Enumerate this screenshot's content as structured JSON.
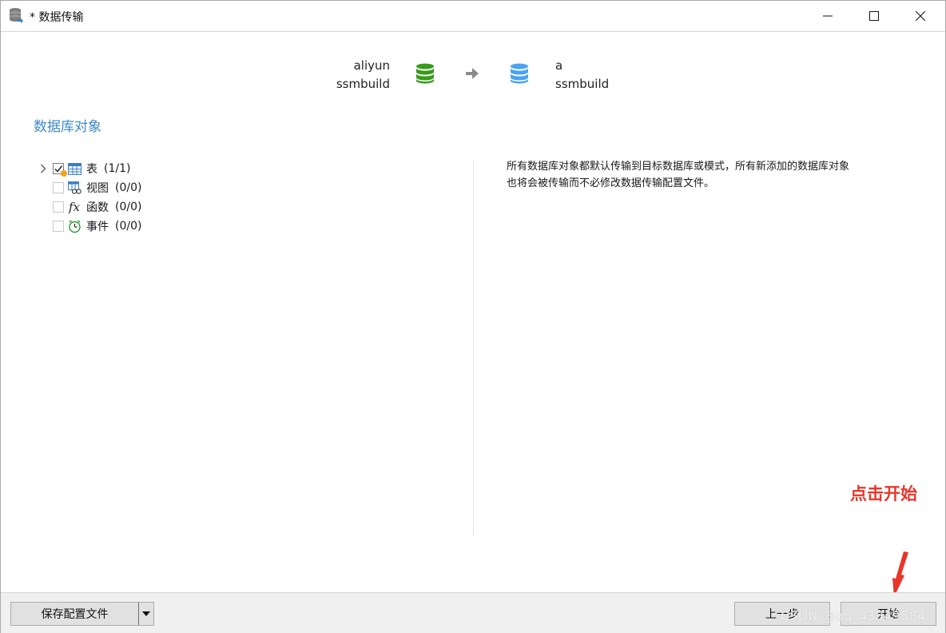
{
  "window": {
    "title": "* 数据传输",
    "icon": "database-transfer-icon"
  },
  "header": {
    "source": {
      "connection": "aliyun",
      "database": "ssmbuild",
      "icon": "database-icon",
      "color": "#3a9a1c"
    },
    "target": {
      "connection": "a",
      "database": "ssmbuild",
      "icon": "database-icon",
      "color": "#4aa3ee"
    }
  },
  "section_title": "数据库对象",
  "tree": {
    "items": [
      {
        "label": "表",
        "count": "(1/1)",
        "checked": true,
        "icon": "table-icon"
      },
      {
        "label": "视图",
        "count": "(0/0)",
        "checked": false,
        "icon": "view-icon"
      },
      {
        "label": "函数",
        "count": "(0/0)",
        "checked": false,
        "icon": "function-icon"
      },
      {
        "label": "事件",
        "count": "(0/0)",
        "checked": false,
        "icon": "event-icon"
      }
    ]
  },
  "description": {
    "line1": "所有数据库对象都默认传输到目标数据库或模式，所有新添加的数据库对象",
    "line2": "也将会被传输而不必修改数据传输配置文件。"
  },
  "annotation": {
    "text": "点击开始",
    "color": "#e8352a"
  },
  "footer": {
    "save_profile_label": "保存配置文件",
    "prev_label": "上一步",
    "start_label": "开始",
    "watermark": "CSDN @qq_43849584"
  }
}
